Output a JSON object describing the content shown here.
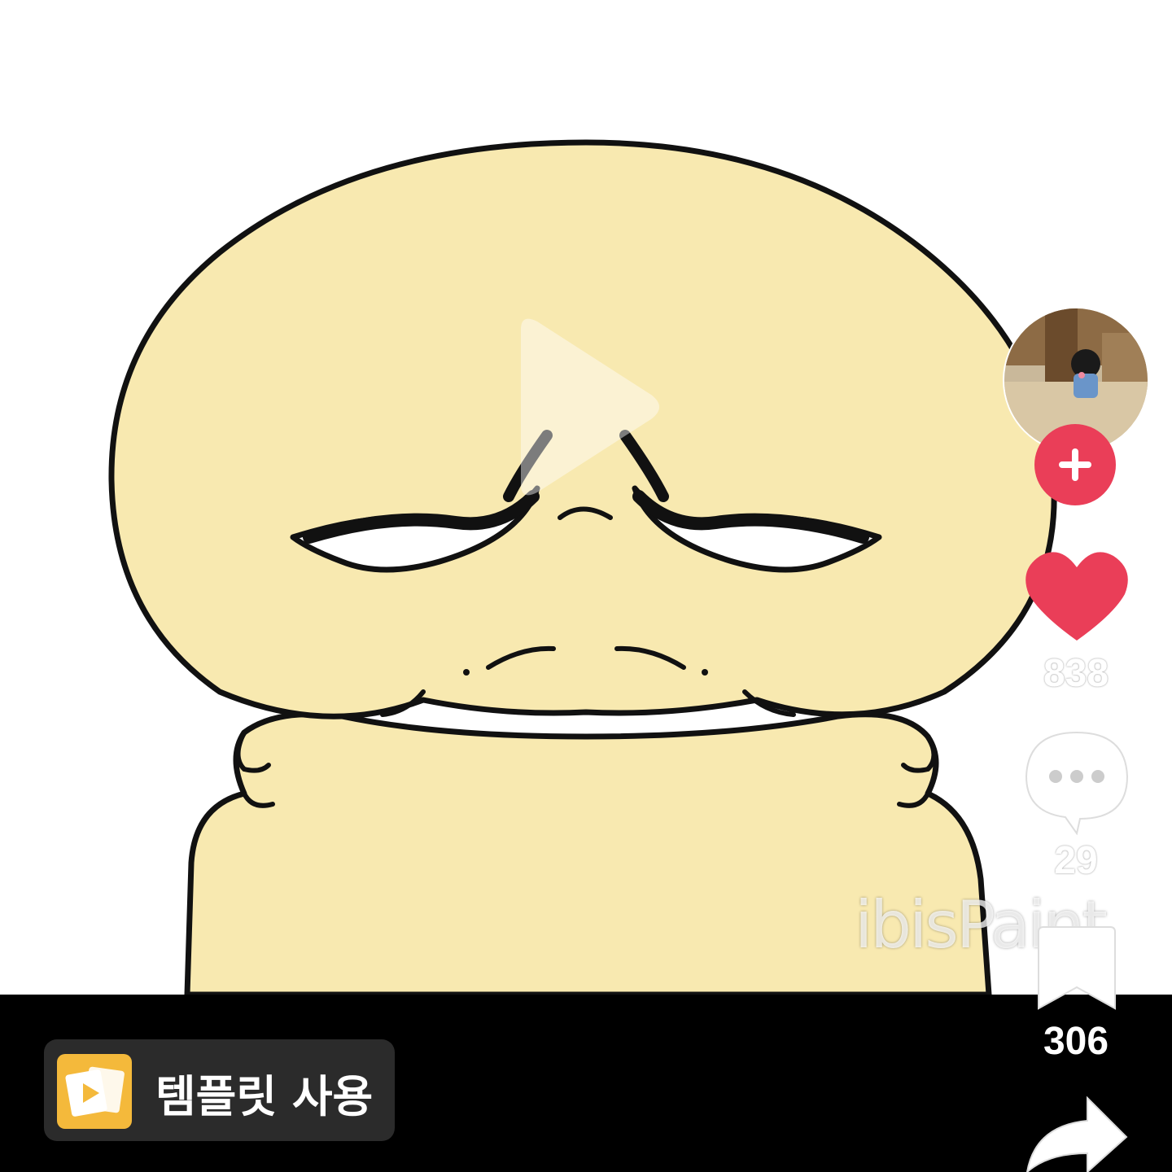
{
  "video": {
    "watermark": "ibisPaint"
  },
  "actions": {
    "likes": "838",
    "comments": "29",
    "bookmarks": "306"
  },
  "template": {
    "label": "템플릿 사용"
  },
  "colors": {
    "accent": "#ea3e58",
    "character_fill": "#f8e9b0",
    "template_icon_bg": "#f4b93b",
    "bottom_bar": "#000000"
  },
  "icons": [
    "play-icon",
    "plus-icon",
    "heart-icon",
    "comment-icon",
    "bookmark-icon",
    "share-icon",
    "template-app-icon"
  ]
}
